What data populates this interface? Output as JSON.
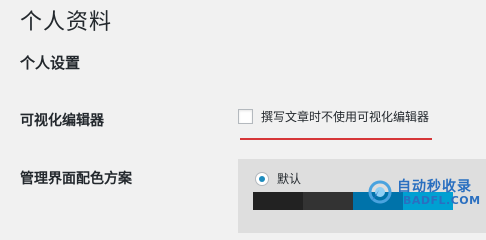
{
  "page": {
    "title": "个人资料",
    "section_title": "个人设置"
  },
  "visual_editor": {
    "label": "可视化编辑器",
    "checkbox_text": "撰写文章时不使用可视化编辑器",
    "checked": false,
    "highlight_color": "#d63638"
  },
  "color_scheme": {
    "label": "管理界面配色方案",
    "selected_option": "默认",
    "swatches": [
      "#222222",
      "#333333",
      "#0073aa",
      "#00a0d2"
    ]
  },
  "watermark": {
    "cn_text": "自动秒收录",
    "en_text": "BADFL.COM"
  }
}
